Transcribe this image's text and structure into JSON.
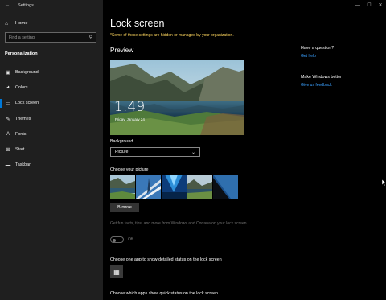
{
  "window": {
    "app_title": "Settings",
    "controls": {
      "minimize": "—",
      "maximize": "☐",
      "close": "✕"
    }
  },
  "sidebar": {
    "home_label": "Home",
    "search_placeholder": "Find a setting",
    "section_title": "Personalization",
    "items": [
      {
        "label": "Background",
        "icon": "picture-icon"
      },
      {
        "label": "Colors",
        "icon": "palette-icon"
      },
      {
        "label": "Lock screen",
        "icon": "lock-screen-icon",
        "active": true
      },
      {
        "label": "Themes",
        "icon": "brush-icon"
      },
      {
        "label": "Fonts",
        "icon": "font-icon"
      },
      {
        "label": "Start",
        "icon": "start-icon"
      },
      {
        "label": "Taskbar",
        "icon": "taskbar-icon"
      }
    ]
  },
  "main": {
    "title": "Lock screen",
    "org_note": "*Some of these settings are hidden or managed by your organization.",
    "preview_heading": "Preview",
    "preview_time": "1:49",
    "preview_date": "Friday, January 24",
    "background_label": "Background",
    "background_value": "Picture",
    "choose_picture_label": "Choose your picture",
    "browse_label": "Browse",
    "fun_facts_text": "Get fun facts, tips, and more from Windows and Cortana on your lock screen",
    "fun_facts_toggle": "Off",
    "detail_status_label": "Choose one app to show detailed status on the lock screen",
    "quick_status_label": "Choose which apps show quick status on the lock screen"
  },
  "side_panel": {
    "question_heading": "Have a question?",
    "get_help": "Get help",
    "better_heading": "Make Windows better",
    "feedback": "Give us feedback"
  },
  "colors": {
    "accent": "#0078d7",
    "link": "#3aa0ff",
    "warning": "#ffd75e",
    "sidebar_bg": "#1f1f1f"
  }
}
